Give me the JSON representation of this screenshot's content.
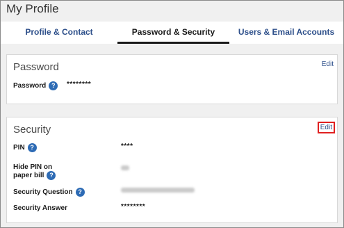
{
  "page": {
    "title": "My Profile"
  },
  "tabs": [
    {
      "label": "Profile & Contact"
    },
    {
      "label": "Password & Security"
    },
    {
      "label": "Users & Email Accounts"
    }
  ],
  "password_card": {
    "title": "Password",
    "edit_label": "Edit",
    "rows": [
      {
        "label": "Password",
        "value": "********"
      }
    ]
  },
  "security_card": {
    "title": "Security",
    "edit_label": "Edit",
    "rows": [
      {
        "label": "PIN",
        "value": "****"
      },
      {
        "label_line1": "Hide PIN on",
        "label_line2": "paper bill"
      },
      {
        "label": "Security Question"
      },
      {
        "label": "Security Answer",
        "value": "********"
      }
    ]
  },
  "help_icon_glyph": "?",
  "colors": {
    "link": "#2d4f8a",
    "help_icon": "#2d6bb5",
    "highlight": "#e02020"
  }
}
